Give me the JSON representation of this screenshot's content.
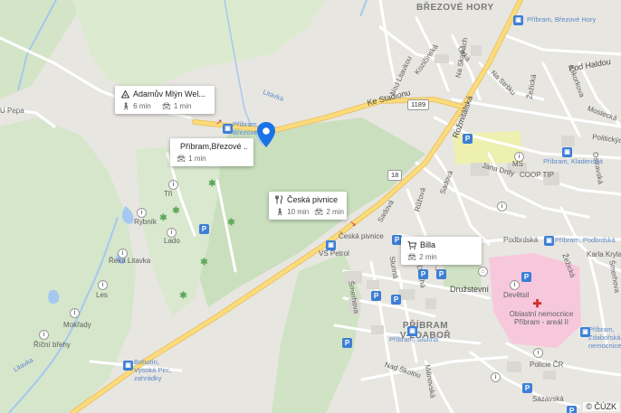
{
  "map": {
    "copyright": "© ČÚZK",
    "route_shields": [
      "1189",
      "18"
    ],
    "streets": [
      "Ke Stadionu",
      "Rožmitálská",
      "Nad Litavkou",
      "Kozičínská",
      "Na Skalkách",
      "Úzká",
      "Na Stršku",
      "Žežická",
      "Pod Haldou",
      "Klikorkova",
      "Mostecká",
      "Politických vězňů",
      "Ostravská",
      "Jana Drdy",
      "Sadová",
      "Růžová",
      "Sadová",
      "Podbrdská",
      "Karla Kryla",
      "Žežická",
      "Šmerhova",
      "Slunná",
      "Dlouhá",
      "Družstevní",
      "Nad Školou",
      "Milinovská",
      "Sázavská",
      "Šmerhova"
    ],
    "places": {
      "brezove_hory": "BŘEZOVÉ HORY",
      "pribram_vzdabor": "PŘÍBRAM V-ZDABOŘ",
      "bus_pribram_brezove_hory": "Příbram, Březové Hory",
      "bus_pribram_brezove_hory_2": "Příbram, Březové Hory",
      "bus_pribram_kladenska": "Příbram, Kladenská",
      "bus_pribram_podbrdska": "Příbram, Podbrdská",
      "bus_pribram_slunna": "Příbram, Slunná",
      "bus_pribram_zdaborska": "Příbram, Zdabořská nemocnice",
      "bus_bohutin": "Bohutín, Vysoká Pec, zahrádky",
      "ceska_pivnice_label": "Česká pivnice",
      "vs_petrol": "VS Petrol",
      "coop_tip": "COOP TIP",
      "ms": "MŠ",
      "devetsil": "Devětsil",
      "nemocnice": "Oblastní nemocnice Příbram - areál II",
      "policie": "Policie ČR",
      "billa_label": "Billa",
      "reka_litavka": "Řeka Litavka",
      "rybnik": "Rybník",
      "les": "Les",
      "lado": "Lado",
      "tri": "Tři",
      "mokrady": "Mokřady",
      "ricni_brehy": "Říční břehy",
      "litavka": "Litavka",
      "litavka2": "Litavka",
      "u_pepa": "U Pepa"
    }
  },
  "cards": [
    {
      "title": "Adamův Mlýn Wel...",
      "walk": "6 min",
      "car": "1 min",
      "icon": "hotel-icon"
    },
    {
      "title": "Příbram,Březové ...",
      "car": "1 min",
      "icon": "bus-icon"
    },
    {
      "title": "Česká pivnice",
      "walk": "10 min",
      "car": "2 min",
      "icon": "restaurant-icon"
    },
    {
      "title": "Billa",
      "car": "2 min",
      "icon": "cart-icon"
    }
  ],
  "colors": {
    "water": "#a5c8f0",
    "green": "#c8dfbf",
    "main_road": "#fcdc7a",
    "road": "#ffffff",
    "pin": "#1a73e8",
    "hospital": "#f7c8dc",
    "school": "#eef0b0"
  }
}
